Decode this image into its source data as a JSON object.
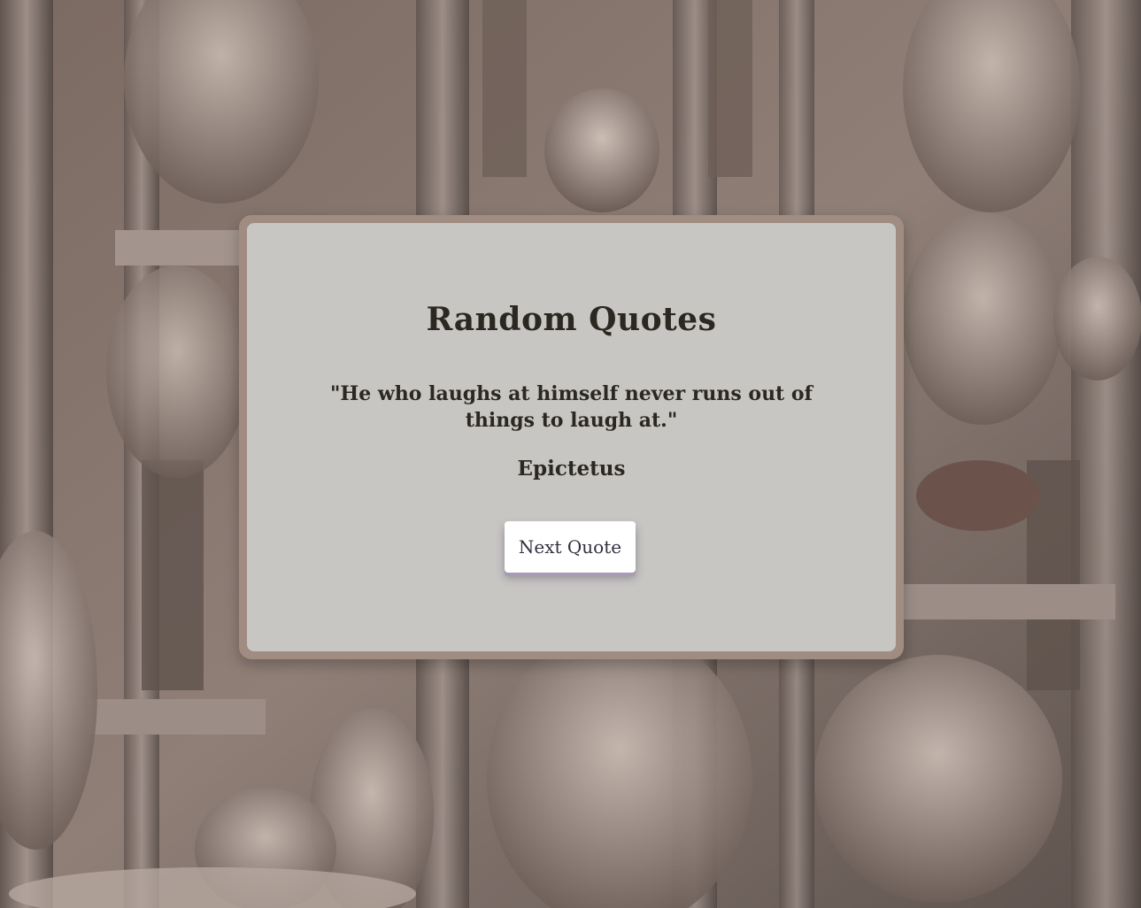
{
  "page": {
    "title": "Random Quotes",
    "quote": "\"He who laughs at himself never runs out of things to laugh at.\"",
    "author": "Epictetus",
    "next_button_label": "Next Quote"
  },
  "colors": {
    "card_border": "#a08c81",
    "card_background": "#c8c6c3",
    "text": "#2b2821",
    "button_background": "#ffffff",
    "button_shadow": "#a99bb3"
  },
  "background": {
    "description_icon": "cathedral-facade-background-image"
  }
}
